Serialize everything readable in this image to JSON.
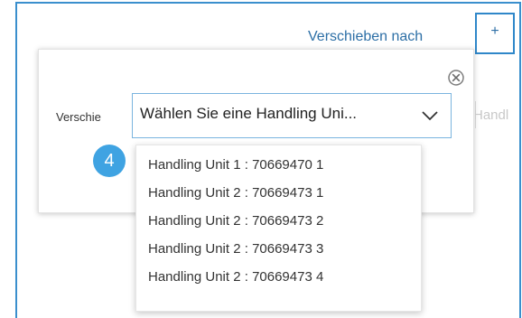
{
  "header": {
    "move_to_label": "Verschieben nach",
    "add_button_label": "+"
  },
  "popover": {
    "field_label": "Verschie",
    "select_placeholder": "Wählen Sie eine Handling Uni...",
    "adjacent_field_text": "Handl"
  },
  "callout": {
    "step_number": "4"
  },
  "dropdown": {
    "options": [
      "Handling Unit 1 : 70669470 1",
      "Handling Unit 2 : 70669473 1",
      "Handling Unit 2 : 70669473 2",
      "Handling Unit 2 : 70669473 3",
      "Handling Unit 2 : 70669473 4"
    ]
  },
  "colors": {
    "accent_blue": "#2f87c9",
    "link_blue": "#2d6fa6",
    "badge_blue": "#3fa3e2"
  },
  "icons": {
    "close": "close-icon",
    "chevron": "chevron-down-icon"
  }
}
